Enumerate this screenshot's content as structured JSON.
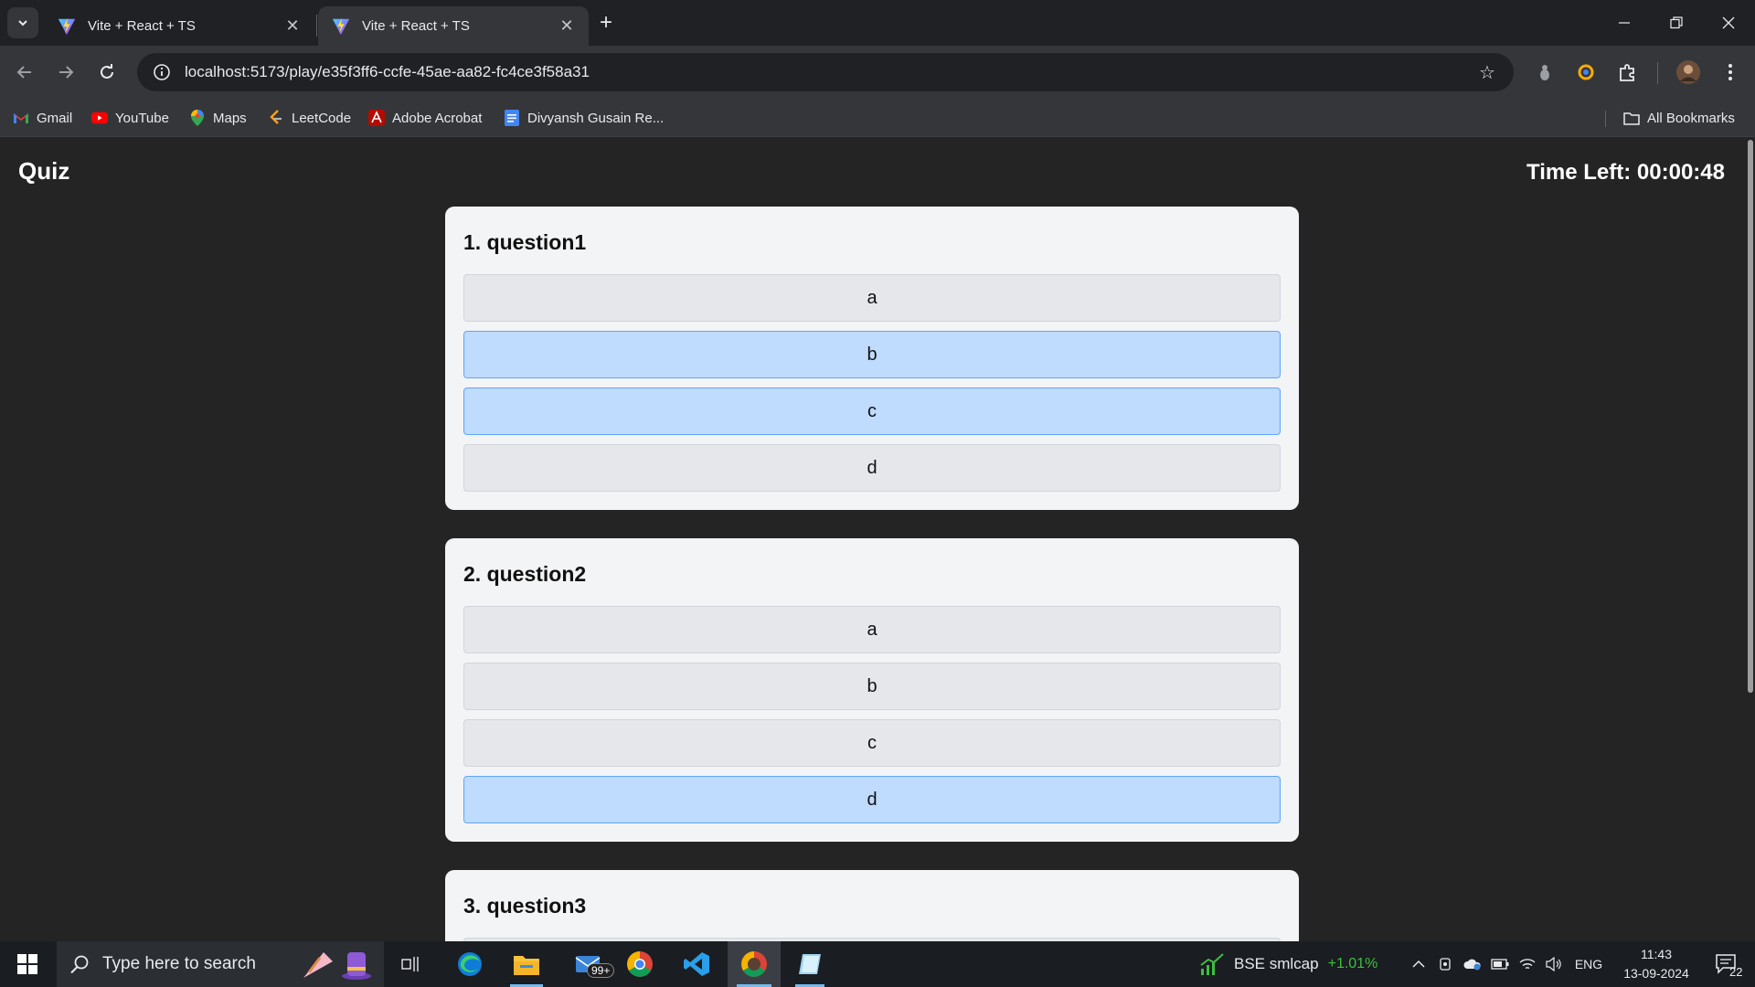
{
  "browser": {
    "tabs": [
      {
        "title": "Vite + React + TS",
        "active": false
      },
      {
        "title": "Vite + React + TS",
        "active": true
      }
    ],
    "url": "localhost:5173/play/e35f3ff6-ccfe-45ae-aa82-fc4ce3f58a31",
    "bookmarks": [
      {
        "label": "Gmail",
        "icon": "gmail-icon"
      },
      {
        "label": "YouTube",
        "icon": "youtube-icon"
      },
      {
        "label": "Maps",
        "icon": "maps-icon"
      },
      {
        "label": "LeetCode",
        "icon": "leetcode-icon"
      },
      {
        "label": "Adobe Acrobat",
        "icon": "acrobat-icon"
      },
      {
        "label": "Divyansh Gusain Re...",
        "icon": "docs-icon"
      }
    ],
    "all_bookmarks_label": "All Bookmarks"
  },
  "page": {
    "title": "Quiz",
    "timer": "Time Left: 00:00:48",
    "questions": [
      {
        "title": "1. question1",
        "options": [
          {
            "label": "a",
            "selected": false
          },
          {
            "label": "b",
            "selected": true
          },
          {
            "label": "c",
            "selected": true
          },
          {
            "label": "d",
            "selected": false
          }
        ]
      },
      {
        "title": "2. question2",
        "options": [
          {
            "label": "a",
            "selected": false
          },
          {
            "label": "b",
            "selected": false
          },
          {
            "label": "c",
            "selected": false
          },
          {
            "label": "d",
            "selected": true
          }
        ]
      },
      {
        "title": "3. question3",
        "options": []
      }
    ]
  },
  "colors": {
    "option_default": "#e5e7eb",
    "option_selected": "#bfdbfe",
    "card_bg": "#f3f4f6",
    "page_bg": "#242424"
  },
  "taskbar": {
    "search_placeholder": "Type here to search",
    "mail_badge": "99+",
    "stock_name": "BSE smlcap",
    "stock_change": "+1.01%",
    "language": "ENG",
    "time": "11:43",
    "date": "13-09-2024",
    "notifications": "22"
  }
}
